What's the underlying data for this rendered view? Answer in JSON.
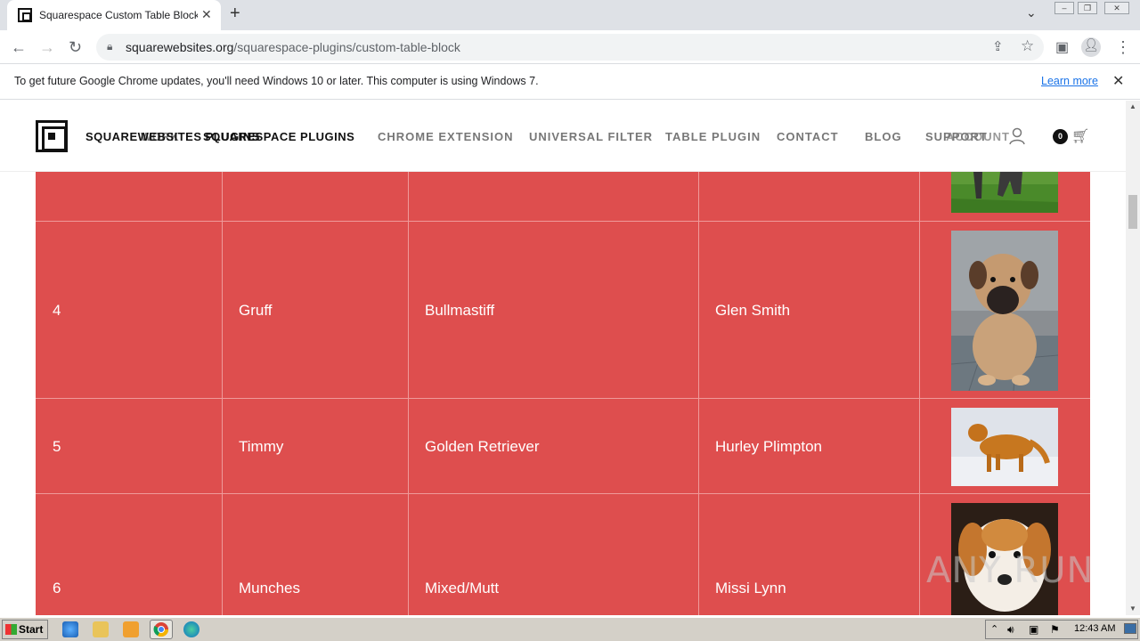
{
  "browser": {
    "tab_title": "Squarespace Custom Table Block Plu",
    "url_host": "squarewebsites.org",
    "url_path": "/squarespace-plugins/custom-table-block",
    "infobar_message": "To get future Google Chrome updates, you'll need Windows 10 or later. This computer is using Windows 7.",
    "infobar_link": "Learn more"
  },
  "site": {
    "brand_overlap_1": "SQUAREWEBSITES PLUGINS",
    "brand_overlap_2": "WORK",
    "brand_overlap_3": "SQUARESPACE PLUGINS",
    "nav": [
      "CHROME EXTENSION",
      "UNIVERSAL FILTER",
      "TABLE PLUGIN",
      "CONTACT",
      "BLOG"
    ],
    "nav_overlap_a": "SUPPORT",
    "nav_overlap_b": "ACCOUNT",
    "cart_count": "0"
  },
  "table": {
    "rows": [
      {
        "num": "",
        "name": "",
        "breed": "",
        "owner": "",
        "img": "partial-dog"
      },
      {
        "num": "4",
        "name": "Gruff",
        "breed": "Bullmastiff",
        "owner": "Glen Smith",
        "img": "bullmastiff-puppy"
      },
      {
        "num": "5",
        "name": "Timmy",
        "breed": "Golden Retriever",
        "owner": "Hurley Plimpton",
        "img": "golden-retriever-snow"
      },
      {
        "num": "6",
        "name": "Munches",
        "breed": "Mixed/Mutt",
        "owner": "Missi Lynn",
        "img": "mixed-dog"
      }
    ]
  },
  "watermark": "ANY RUN",
  "taskbar": {
    "start_label": "Start",
    "clock": "12:43 AM"
  },
  "colors": {
    "table_bg": "#de4e4e",
    "table_line": "#ef9a9a",
    "link": "#1a73e8"
  }
}
